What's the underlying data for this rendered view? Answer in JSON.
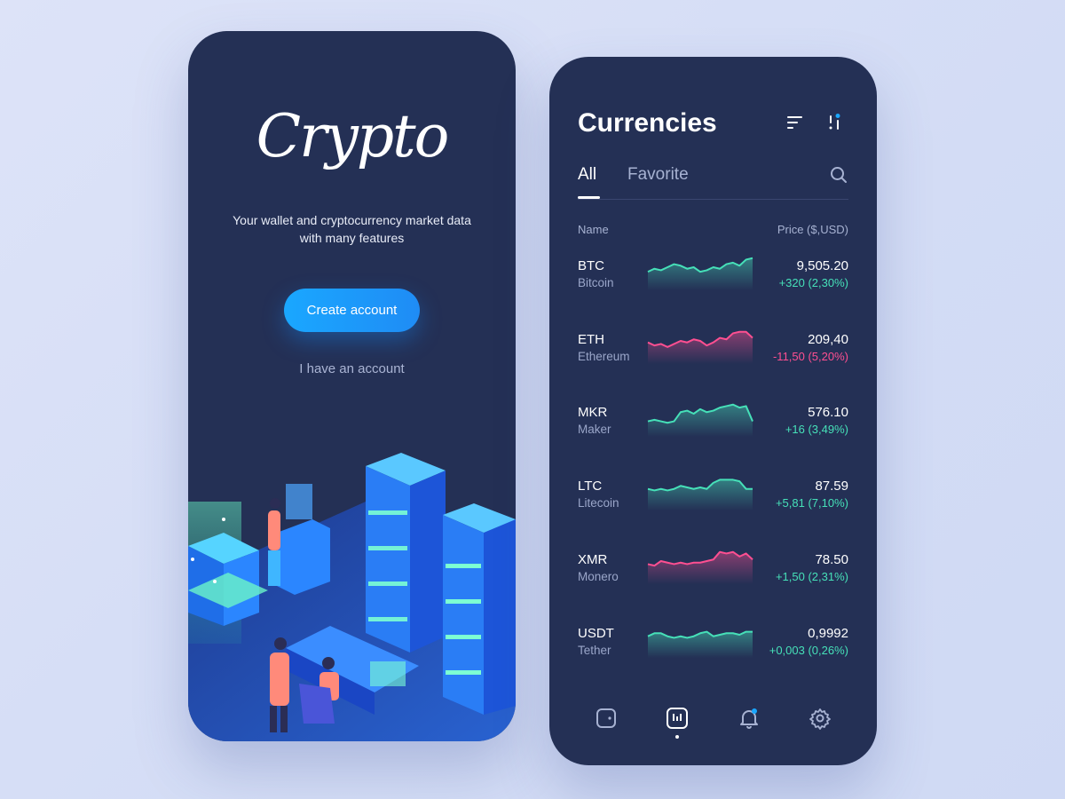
{
  "welcome": {
    "logo_text": "Crypto",
    "tagline_line1": "Your wallet and cryptocurrency market data",
    "tagline_line2": "with many features",
    "create_account_label": "Create account",
    "have_account_label": "I have an account"
  },
  "currencies": {
    "title": "Currencies",
    "tabs": [
      {
        "label": "All",
        "active": true
      },
      {
        "label": "Favorite",
        "active": false
      }
    ],
    "columns": {
      "name": "Name",
      "price": "Price ($,USD)"
    },
    "rows": [
      {
        "symbol": "BTC",
        "name": "Bitcoin",
        "price": "9,505.20",
        "change": "+320 (2,30%)",
        "trend": "up",
        "spark": [
          8,
          10,
          9,
          11,
          13,
          12,
          10,
          11,
          8,
          9,
          11,
          10,
          13,
          14,
          12,
          16,
          17
        ]
      },
      {
        "symbol": "ETH",
        "name": "Ethereum",
        "price": "209,40",
        "change": "-11,50 (5,20%)",
        "trend": "down",
        "spark": [
          10,
          8,
          9,
          7,
          9,
          11,
          10,
          12,
          11,
          8,
          10,
          13,
          12,
          16,
          17,
          17,
          13
        ]
      },
      {
        "symbol": "MKR",
        "name": "Maker",
        "price": "576.10",
        "change": "+16 (3,49%)",
        "trend": "up",
        "spark": [
          6,
          7,
          6,
          5,
          6,
          12,
          13,
          11,
          14,
          12,
          13,
          15,
          16,
          17,
          15,
          16,
          6
        ]
      },
      {
        "symbol": "LTC",
        "name": "Litecoin",
        "price": "87.59",
        "change": "+5,81 (7,10%)",
        "trend": "up",
        "spark": [
          10,
          9,
          10,
          9,
          10,
          12,
          11,
          10,
          11,
          10,
          14,
          16,
          16,
          16,
          15,
          10,
          10
        ]
      },
      {
        "symbol": "XMR",
        "name": "Monero",
        "price": "78.50",
        "change": "+1,50 (2,31%)",
        "trend": "up_pink",
        "spark": [
          9,
          8,
          11,
          10,
          9,
          10,
          9,
          10,
          10,
          11,
          12,
          17,
          16,
          17,
          14,
          16,
          12
        ]
      },
      {
        "symbol": "USDT",
        "name": "Tether",
        "price": "0,9992",
        "change": "+0,003 (0,26%)",
        "trend": "up",
        "spark": [
          10,
          12,
          12,
          10,
          9,
          10,
          9,
          10,
          12,
          13,
          10,
          11,
          12,
          12,
          11,
          13,
          13
        ]
      }
    ]
  },
  "nav": {
    "items": [
      {
        "icon": "wallet-icon"
      },
      {
        "icon": "chart-icon",
        "active": true
      },
      {
        "icon": "bell-icon",
        "badge": true
      },
      {
        "icon": "gear-icon"
      }
    ]
  },
  "colors": {
    "up": "#46e0b8",
    "down": "#ff4f91",
    "accent": "#1aa7ff",
    "phone_bg": "#243055"
  }
}
